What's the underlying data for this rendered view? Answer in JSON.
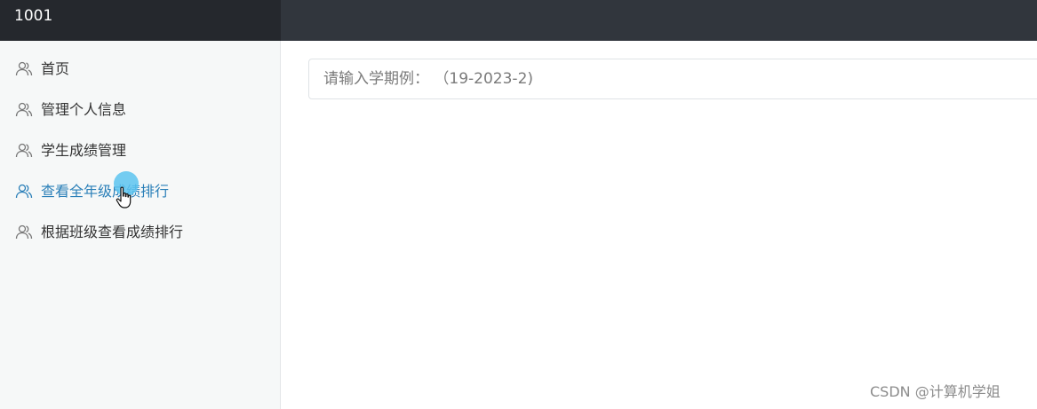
{
  "header": {
    "title": "1001"
  },
  "sidebar": {
    "items": [
      {
        "label": "首页",
        "icon": "users-icon",
        "active": false
      },
      {
        "label": "管理个人信息",
        "icon": "users-icon",
        "active": false
      },
      {
        "label": "学生成绩管理",
        "icon": "users-icon",
        "active": false
      },
      {
        "label": "查看全年级成绩排行",
        "icon": "users-icon",
        "active": true
      },
      {
        "label": "根据班级查看成绩排行",
        "icon": "users-icon",
        "active": false
      }
    ]
  },
  "main": {
    "search": {
      "placeholder": "请输入学期例： （19-2023-2)",
      "value": ""
    }
  },
  "watermark": "CSDN @计算机学姐",
  "colors": {
    "topbar": "#31363d",
    "topbar_brand": "#25282d",
    "sidebar_bg": "#f6f8f8",
    "active_text": "#2a7fb8",
    "text": "#333333"
  }
}
